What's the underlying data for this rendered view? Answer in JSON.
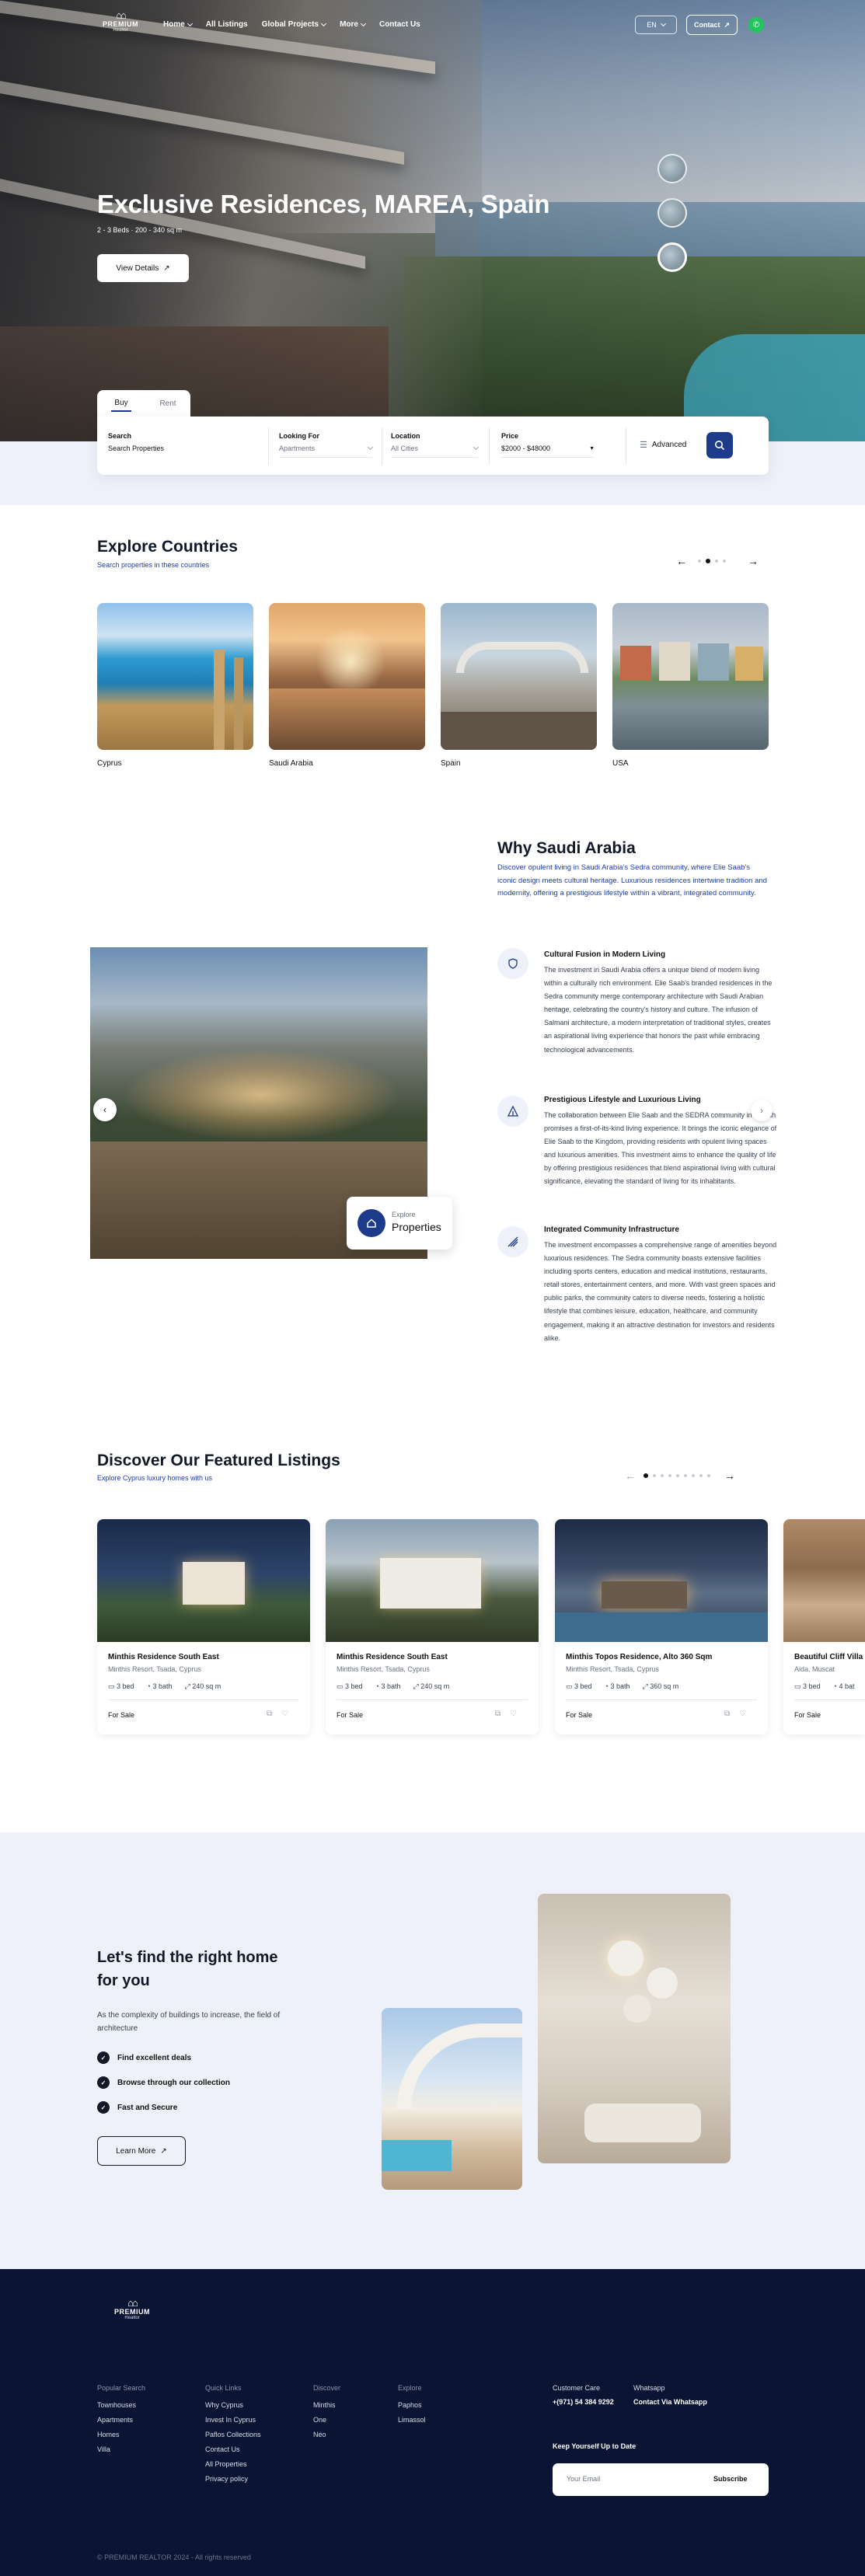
{
  "nav": {
    "logo_line1": "PREMIUM",
    "logo_line2": "Realtor",
    "links": [
      "Home",
      "All Listings",
      "Global Projects",
      "More",
      "Contact Us"
    ],
    "language": "EN",
    "contact_label": "Contact"
  },
  "hero": {
    "title": "Exclusive Residences, MAREA, Spain",
    "subtitle": "2 - 3 Beds · 200 - 340 sq m",
    "cta": "View Details"
  },
  "search": {
    "tabs": [
      "Buy",
      "Rent"
    ],
    "fields": [
      {
        "label": "Search",
        "value": "Search Properties"
      },
      {
        "label": "Looking For",
        "value": "Apartments"
      },
      {
        "label": "Location",
        "value": "All Cities"
      },
      {
        "label": "Price",
        "value": "$2000 - $48000"
      }
    ],
    "advanced_label": "Advanced"
  },
  "countries": {
    "title": "Explore Countries",
    "subtitle": "Search properties in these countries",
    "items": [
      "Cyprus",
      "Saudi Arabia",
      "Spain",
      "USA"
    ]
  },
  "why": {
    "title": "Why Saudi Arabia",
    "intro": "Discover opulent living in Saudi Arabia's Sedra community, where Elie Saab's iconic design meets cultural heritage. Luxurious residences intertwine tradition and modernity, offering a prestigious lifestyle within a vibrant, integrated community.",
    "badge_small": "Explore",
    "badge_big": "Properties",
    "features": [
      {
        "title": "Cultural Fusion in Modern Living",
        "text": "The investment in Saudi Arabia offers a unique blend of modern living within a culturally rich environment. Elie Saab's branded residences in the Sedra community merge contemporary architecture with Saudi Arabian heritage, celebrating the country's history and culture. The infusion of Salmani architecture, a modern interpretation of traditional styles, creates an aspirational living experience that honors the past while embracing technological advancements."
      },
      {
        "title": "Prestigious Lifestyle and Luxurious Living",
        "text": "The collaboration between Elie Saab and the SEDRA community in Riyadh promises a first-of-its-kind living experience. It brings the iconic elegance of Elie Saab to the Kingdom, providing residents with opulent living spaces and luxurious amenities. This investment aims to enhance the quality of life by offering prestigious residences that blend aspirational living with cultural significance, elevating the standard of living for its inhabitants."
      },
      {
        "title": "Integrated Community Infrastructure",
        "text": "The investment encompasses a comprehensive range of amenities beyond luxurious residences. The Sedra community boasts extensive facilities including sports centers, education and medical institutions, restaurants, retail stores, entertainment centers, and more. With vast green spaces and public parks, the community caters to diverse needs, fostering a holistic lifestyle that combines leisure, education, healthcare, and community engagement, making it an attractive destination for investors and residents alike."
      }
    ]
  },
  "listings": {
    "title": "Discover Our Featured Listings",
    "subtitle": "Explore Cyprus luxury homes with us",
    "items": [
      {
        "name": "Minthis Residence South East",
        "location": "Minthis Resort, Tsada, Cyprus",
        "bed": "3 bed",
        "bath": "3 bath",
        "area": "240 sq m",
        "status": "For Sale"
      },
      {
        "name": "Minthis Residence South East",
        "location": "Minthis Resort, Tsada, Cyprus",
        "bed": "3 bed",
        "bath": "3 bath",
        "area": "240 sq m",
        "status": "For Sale"
      },
      {
        "name": "Minthis Topos Residence, Alto 360 Sqm",
        "location": "Minthis Resort, Tsada, Cyprus",
        "bed": "3 bed",
        "bath": "3 bath",
        "area": "360 sq m",
        "status": "For Sale"
      },
      {
        "name": "Beautiful Cliff Villa",
        "location": "Aida, Muscat",
        "bed": "3 bed",
        "bath": "4 bat",
        "area": "",
        "status": "For Sale"
      }
    ]
  },
  "find": {
    "title": "Let's find the right home for you",
    "desc": "As the complexity of buildings to increase, the field of architecture",
    "checks": [
      "Find excellent deals",
      "Browse through our collection",
      "Fast and Secure"
    ],
    "cta": "Learn More"
  },
  "footer": {
    "logo_line1": "PREMIUM",
    "logo_line2": "Realtor",
    "cols": [
      {
        "title": "Popular Search",
        "items": [
          "Townhouses",
          "Apartments",
          "Homes",
          "Villa"
        ]
      },
      {
        "title": "Quick Links",
        "items": [
          "Why Cyprus",
          "Invest In Cyprus",
          "Paflos Collections",
          "Contact Us",
          "All Properties",
          "Privacy policy"
        ]
      },
      {
        "title": "Discover",
        "items": [
          "Minthis",
          "One",
          "Neo"
        ]
      },
      {
        "title": "Explore",
        "items": [
          "Paphos",
          "Limassol"
        ]
      }
    ],
    "care_label": "Customer Care",
    "care_phone": "+(971) 54 384 9292",
    "wa_label": "Whatsapp",
    "wa_value": "Contact Via Whatsapp",
    "newsletter_title": "Keep Yourself Up to Date",
    "email_placeholder": "Your Email",
    "subscribe": "Subscribe",
    "copyright": "© PREMIUM REALTOR 2024 - All rights reserved"
  },
  "colors": {
    "brand": "#1e3a8a",
    "footer": "#0b1533",
    "section_bg": "#eef1f9",
    "whatsapp": "#22c55e"
  }
}
